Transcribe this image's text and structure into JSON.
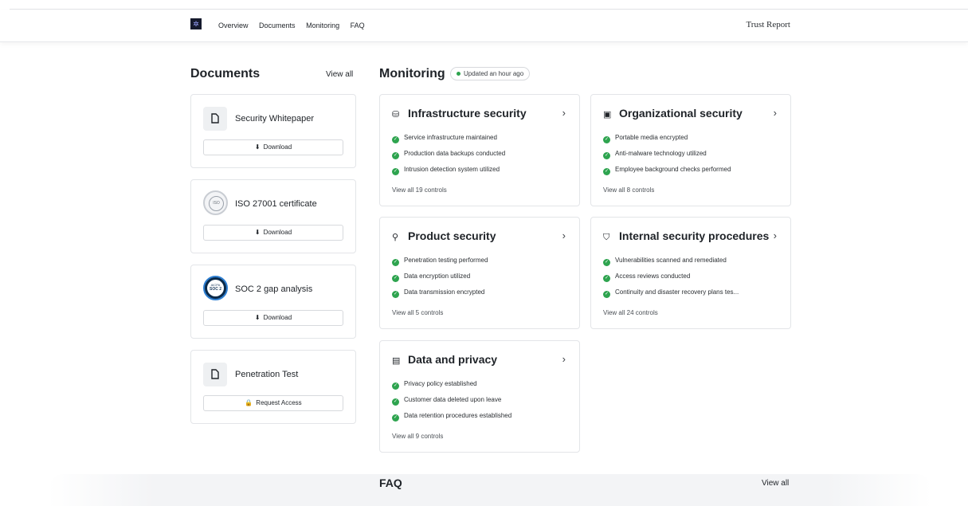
{
  "nav": {
    "links": [
      "Overview",
      "Documents",
      "Monitoring",
      "FAQ"
    ],
    "trust_report": "Trust Report"
  },
  "documents": {
    "title": "Documents",
    "view_all": "View all",
    "items": [
      {
        "title": "Security Whitepaper",
        "action": "Download",
        "action_icon": "download-icon"
      },
      {
        "title": "ISO 27001 certificate",
        "action": "Download",
        "action_icon": "download-icon"
      },
      {
        "title": "SOC 2 gap analysis",
        "action": "Download",
        "action_icon": "download-icon"
      },
      {
        "title": "Penetration Test",
        "action": "Request Access",
        "action_icon": "lock-icon"
      }
    ],
    "badges": {
      "iso_text": "ISO",
      "aicpa_text": "AICPA",
      "soc2_text": "SOC 2"
    }
  },
  "monitoring": {
    "title": "Monitoring",
    "updated": "Updated an hour ago",
    "cards": [
      {
        "title": "Infrastructure security",
        "icon": "database-icon",
        "items": [
          "Service infrastructure maintained",
          "Production data backups conducted",
          "Intrusion detection system utilized"
        ],
        "more": "View all 19 controls"
      },
      {
        "title": "Organizational security",
        "icon": "building-icon",
        "items": [
          "Portable media encrypted",
          "Anti-malware technology utilized",
          "Employee background checks performed"
        ],
        "more": "View all 8 controls"
      },
      {
        "title": "Product security",
        "icon": "link-icon",
        "items": [
          "Penetration testing performed",
          "Data encryption utilized",
          "Data transmission encrypted"
        ],
        "more": "View all 5 controls"
      },
      {
        "title": "Internal security procedures",
        "icon": "shield-icon",
        "items": [
          "Vulnerabilities scanned and remediated",
          "Access reviews conducted",
          "Continuity and disaster recovery plans tes..."
        ],
        "more": "View all 24 controls"
      },
      {
        "title": "Data and privacy",
        "icon": "document-lock-icon",
        "items": [
          "Privacy policy established",
          "Customer data deleted upon leave",
          "Data retention procedures established"
        ],
        "more": "View all 9 controls"
      }
    ]
  },
  "faq": {
    "title": "FAQ",
    "view_all": "View all"
  },
  "colors": {
    "check": "#2ea44f",
    "logo_bg": "#151a2d"
  }
}
